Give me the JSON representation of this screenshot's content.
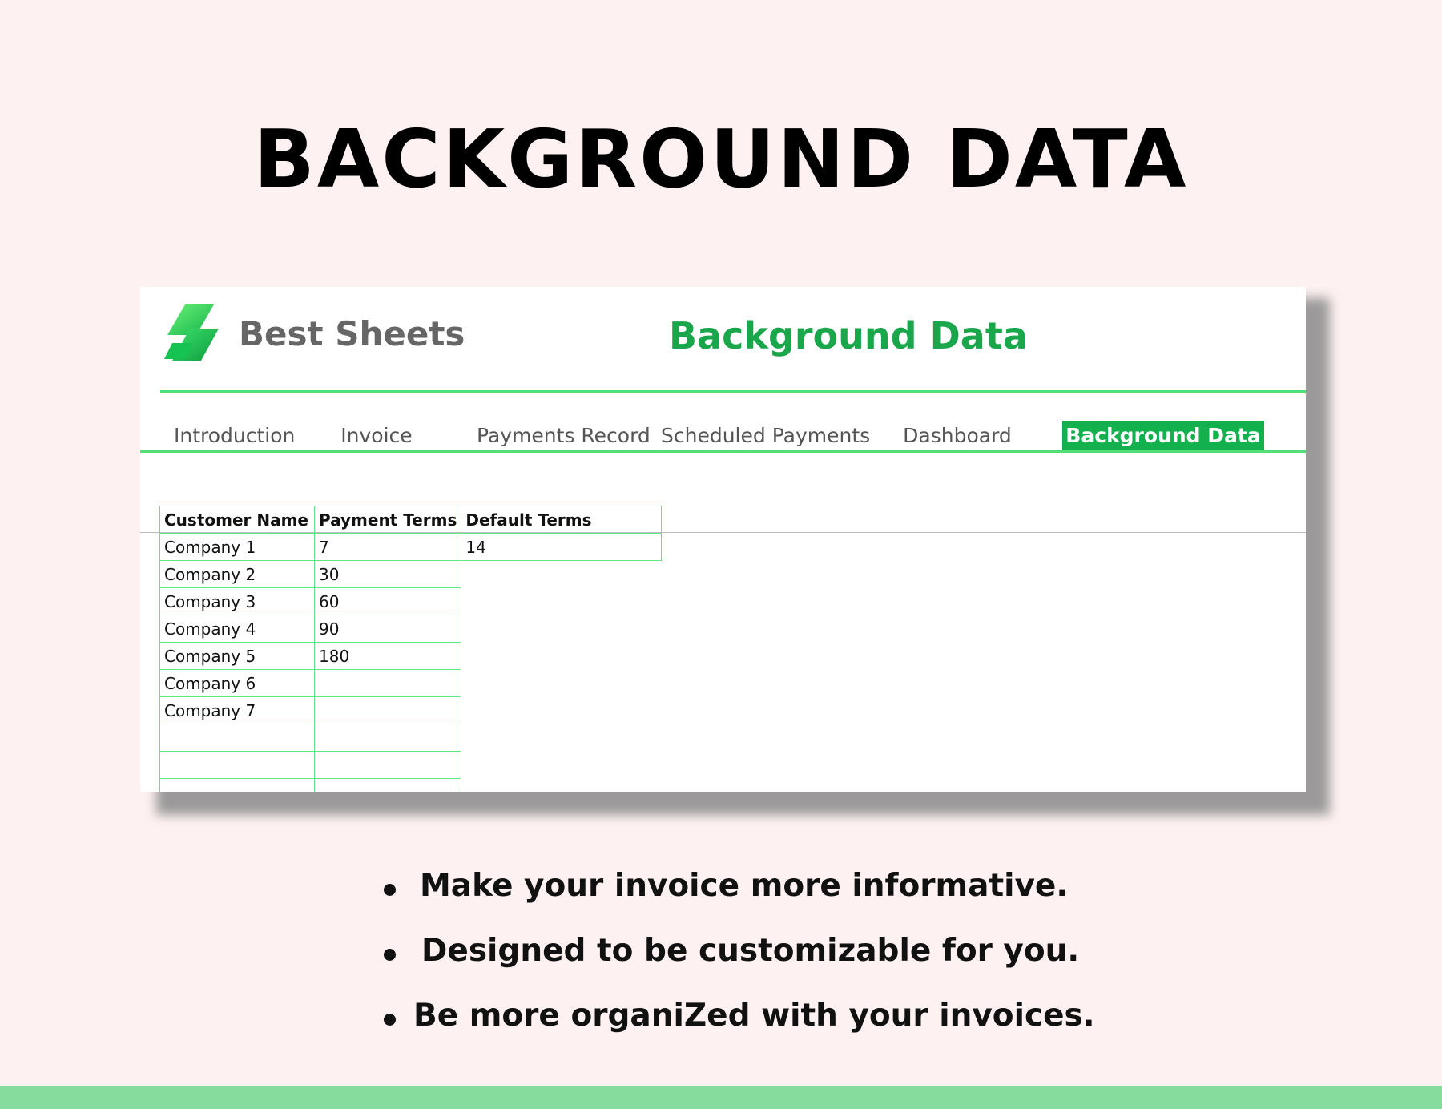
{
  "page": {
    "heading": "BACKGROUND DATA"
  },
  "sheet": {
    "brand": "Best Sheets",
    "title": "Background Data",
    "tabs": [
      {
        "label": "Introduction",
        "active": false
      },
      {
        "label": "Invoice",
        "active": false
      },
      {
        "label": "Payments Record",
        "active": false
      },
      {
        "label": "Scheduled Payments",
        "active": false
      },
      {
        "label": "Dashboard",
        "active": false
      },
      {
        "label": "Background Data",
        "active": true
      }
    ],
    "table": {
      "headers": [
        "Customer Name",
        "Payment Terms",
        "Default Terms"
      ],
      "default_terms_value": "14",
      "rows": [
        {
          "customer": "Company 1",
          "terms": "7"
        },
        {
          "customer": "Company 2",
          "terms": "30"
        },
        {
          "customer": "Company 3",
          "terms": "60"
        },
        {
          "customer": "Company 4",
          "terms": "90"
        },
        {
          "customer": "Company 5",
          "terms": "180"
        },
        {
          "customer": "Company 6",
          "terms": ""
        },
        {
          "customer": "Company 7",
          "terms": ""
        },
        {
          "customer": "",
          "terms": ""
        },
        {
          "customer": "",
          "terms": ""
        },
        {
          "customer": "",
          "terms": ""
        }
      ]
    }
  },
  "bullets": [
    "Make your invoice more informative.",
    "Designed to be customizable for you.",
    "Be more organiZed with your invoices."
  ],
  "colors": {
    "background": "#fdf2f1",
    "accent_green": "#1aa64a",
    "active_tab": "#12b14e",
    "rule_green": "#4fe07a",
    "band_green": "#86dc9c"
  }
}
